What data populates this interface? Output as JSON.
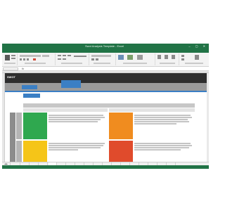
{
  "titlebar": {
    "title": "Swot Analysis Template - Excel"
  },
  "ribbon_tabs": [
    "File",
    "Home",
    "Insert",
    "Page Layout",
    "Formulas",
    "Data",
    "Review",
    "View"
  ],
  "formula_bar": {
    "name_box": "",
    "fx": "fx"
  },
  "dashboard": {
    "brand": "SWOT",
    "nav_tabs": [
      "",
      "",
      "",
      "",
      "",
      "",
      ""
    ],
    "subnav": [
      "",
      ""
    ],
    "button": "",
    "header_top": "",
    "headers": [
      "",
      ""
    ],
    "side_label": "",
    "rows": [
      {
        "label": "",
        "left_box": "",
        "right_box": ""
      },
      {
        "label": "",
        "left_box": "",
        "right_box": ""
      }
    ]
  },
  "sheet_tabs": [
    "",
    "",
    "",
    "",
    "",
    "",
    "",
    "",
    "",
    "",
    "",
    "",
    "",
    "",
    "",
    "",
    "",
    ""
  ],
  "status": {
    "zoom": ""
  },
  "colors": {
    "excel_green": "#217346",
    "accent_blue": "#3b7fc4",
    "green": "#2fa84f",
    "orange": "#f08c1f",
    "yellow": "#f5c518",
    "red": "#e04b2c"
  }
}
